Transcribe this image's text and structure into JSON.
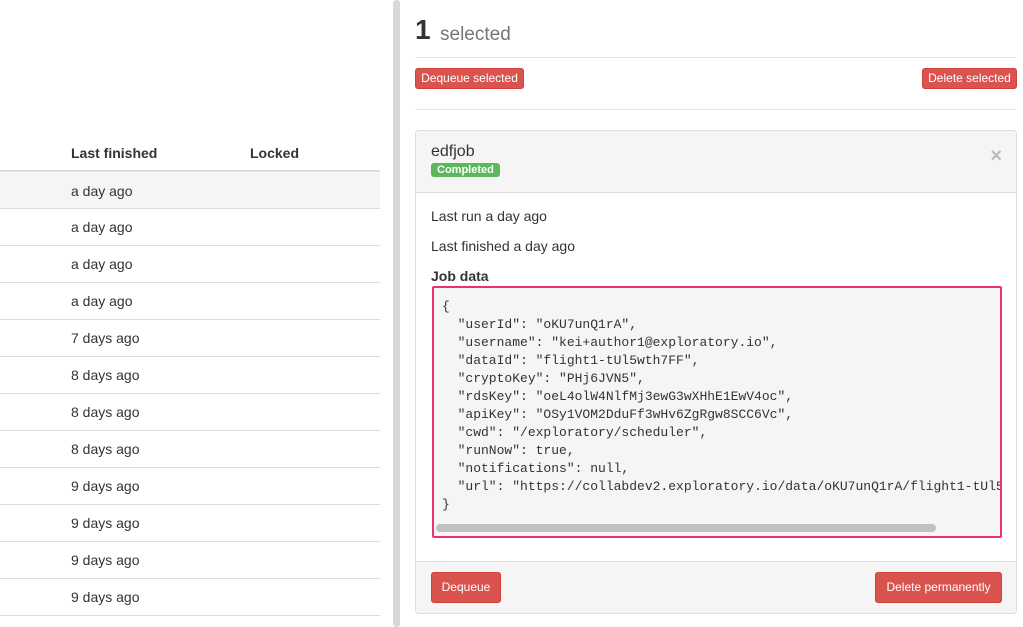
{
  "table": {
    "headers": {
      "last_finished": "Last finished",
      "locked": "Locked"
    },
    "rows": [
      "a day ago",
      "a day ago",
      "a day ago",
      "a day ago",
      "7 days ago",
      "8 days ago",
      "8 days ago",
      "8 days ago",
      "9 days ago",
      "9 days ago",
      "9 days ago",
      "9 days ago"
    ]
  },
  "selection": {
    "count": "1",
    "label": "selected",
    "dequeue_label": "Dequeue selected",
    "delete_label": "Delete selected"
  },
  "job": {
    "name": "edfjob",
    "status": "Completed",
    "close_glyph": "×",
    "last_run": "Last run a day ago",
    "last_finished": "Last finished a day ago",
    "data_label": "Job data",
    "data_json": "{\n  \"userId\": \"oKU7unQ1rA\",\n  \"username\": \"kei+author1@exploratory.io\",\n  \"dataId\": \"flight1-tUl5wth7FF\",\n  \"cryptoKey\": \"PHj6JVN5\",\n  \"rdsKey\": \"oeL4olW4NlfMj3ewG3wXHhE1EwV4oc\",\n  \"apiKey\": \"OSy1VOM2DduFf3wHv6ZgRgw8SCC6Vc\",\n  \"cwd\": \"/exploratory/scheduler\",\n  \"runNow\": true,\n  \"notifications\": null,\n  \"url\": \"https://collabdev2.exploratory.io/data/oKU7unQ1rA/flight1-tUl5\n}",
    "dequeue_label": "Dequeue",
    "delete_label": "Delete permanently"
  },
  "colors": {
    "danger": "#d9534f",
    "success": "#5cb85c",
    "highlight": "#e8336d"
  }
}
